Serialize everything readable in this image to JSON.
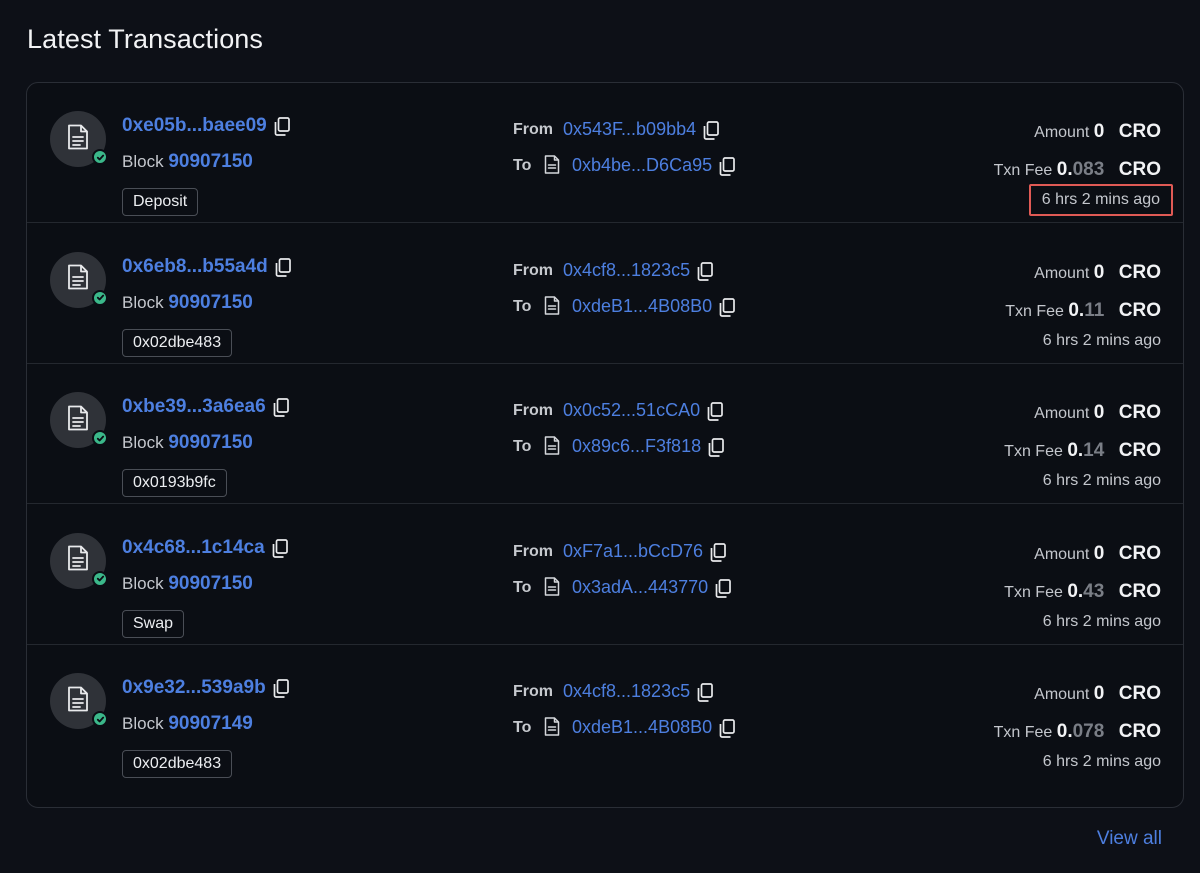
{
  "title": "Latest Transactions",
  "view_all": "View all",
  "labels": {
    "block": "Block",
    "from": "From",
    "to": "To",
    "amount": "Amount",
    "txn_fee": "Txn Fee",
    "currency": "CRO"
  },
  "transactions": [
    {
      "hash": "0xe05b...baee09",
      "block": "90907150",
      "tag": "Deposit",
      "from": "0x543F...b09bb4",
      "to": "0xb4be...D6Ca95",
      "amount": "0",
      "fee_int": "0.",
      "fee_dec": "083",
      "age": "6 hrs 2 mins ago",
      "highlight": true
    },
    {
      "hash": "0x6eb8...b55a4d",
      "block": "90907150",
      "tag": "0x02dbe483",
      "from": "0x4cf8...1823c5",
      "to": "0xdeB1...4B08B0",
      "amount": "0",
      "fee_int": "0.",
      "fee_dec": "11",
      "age": "6 hrs 2 mins ago",
      "highlight": false
    },
    {
      "hash": "0xbe39...3a6ea6",
      "block": "90907150",
      "tag": "0x0193b9fc",
      "from": "0x0c52...51cCA0",
      "to": "0x89c6...F3f818",
      "amount": "0",
      "fee_int": "0.",
      "fee_dec": "14",
      "age": "6 hrs 2 mins ago",
      "highlight": false
    },
    {
      "hash": "0x4c68...1c14ca",
      "block": "90907150",
      "tag": "Swap",
      "from": "0xF7a1...bCcD76",
      "to": "0x3adA...443770",
      "amount": "0",
      "fee_int": "0.",
      "fee_dec": "43",
      "age": "6 hrs 2 mins ago",
      "highlight": false
    },
    {
      "hash": "0x9e32...539a9b",
      "block": "90907149",
      "tag": "0x02dbe483",
      "from": "0x4cf8...1823c5",
      "to": "0xdeB1...4B08B0",
      "amount": "0",
      "fee_int": "0.",
      "fee_dec": "078",
      "age": "6 hrs 2 mins ago",
      "highlight": false
    }
  ],
  "colors": {
    "background": "#0d1017",
    "link": "#4d7fe0",
    "success": "#3bb88a",
    "highlight_border": "#e05a55"
  },
  "icons": {
    "avatar": "document-icon",
    "status": "check-icon",
    "copy": "copy-icon",
    "contract": "document-icon"
  }
}
